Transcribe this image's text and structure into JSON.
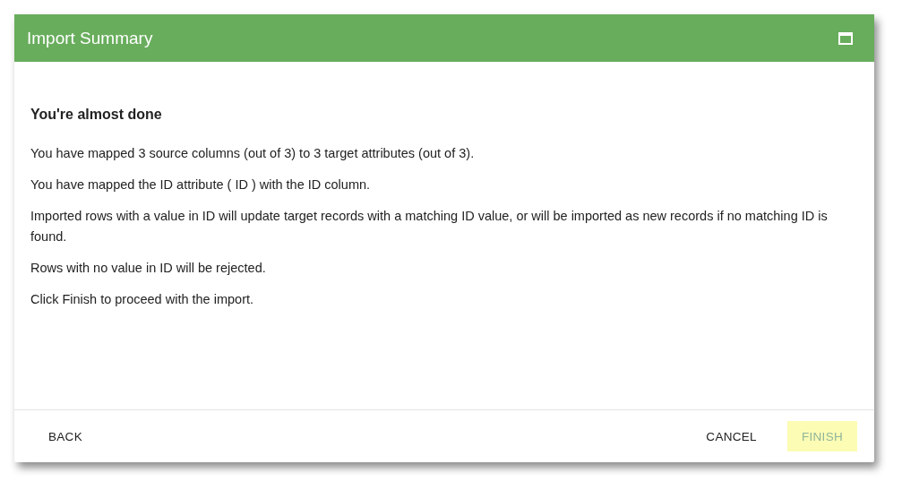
{
  "window": {
    "title": "Import Summary"
  },
  "heading": "You're almost done",
  "paragraphs": [
    "You have mapped 3 source columns (out of 3) to 3 target attributes (out of 3).",
    "You have mapped the ID attribute ( ID ) with the ID column.",
    "Imported rows with a value in ID will update target records with a matching ID value, or will be imported as new records if no matching ID is found.",
    "Rows with no value in ID will be rejected.",
    "Click Finish to proceed with the import."
  ],
  "buttons": [
    {
      "label": "BACK",
      "kind": "left",
      "disabled": false
    },
    {
      "label": "CANCEL",
      "kind": "right",
      "disabled": false
    },
    {
      "label": "FINISH",
      "kind": "right",
      "disabled": true
    }
  ]
}
